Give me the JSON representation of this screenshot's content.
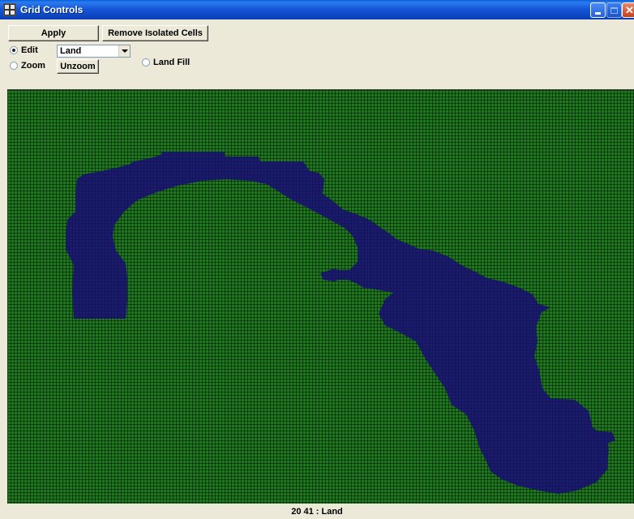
{
  "window": {
    "title": "Grid Controls"
  },
  "toolbar": {
    "apply_label": "Apply",
    "remove_isolated_label": "Remove Isolated Cells",
    "unzoom_label": "Unzoom"
  },
  "modes": {
    "edit_label": "Edit",
    "zoom_label": "Zoom",
    "land_fill_label": "Land Fill",
    "selected": "Edit"
  },
  "cell_type_select": {
    "value": "Land"
  },
  "grid": {
    "land_color": "#1f7a1f",
    "water_color": "#1a1a6e",
    "grid_line_color": "#000000"
  },
  "status": {
    "text": "20  41 : Land"
  }
}
